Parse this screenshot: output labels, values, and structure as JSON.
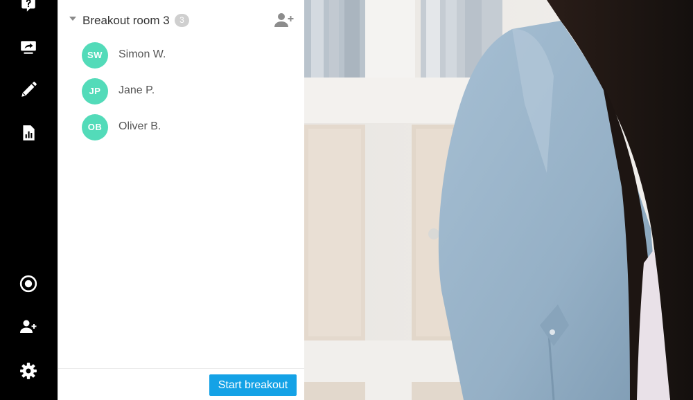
{
  "sidebar": {
    "items": [
      {
        "icon": "question-icon"
      },
      {
        "icon": "share-screen-icon"
      },
      {
        "icon": "pencil-icon"
      },
      {
        "icon": "report-icon"
      },
      {
        "icon": "record-icon"
      },
      {
        "icon": "add-user-icon"
      },
      {
        "icon": "gear-icon"
      }
    ]
  },
  "panel": {
    "room": {
      "title": "Breakout room 3",
      "count": "3",
      "add_icon": "add-person-icon"
    },
    "participants": [
      {
        "initials": "SW",
        "name": "Simon W."
      },
      {
        "initials": "JP",
        "name": "Jane P."
      },
      {
        "initials": "OB",
        "name": "Oliver B."
      }
    ],
    "start_button": "Start breakout"
  },
  "video": {
    "subject": "participant-video-feed"
  },
  "colors": {
    "rail_bg": "#000000",
    "avatar": "#53dbb9",
    "accent": "#14a2e6",
    "badge": "#cfcfcf"
  }
}
